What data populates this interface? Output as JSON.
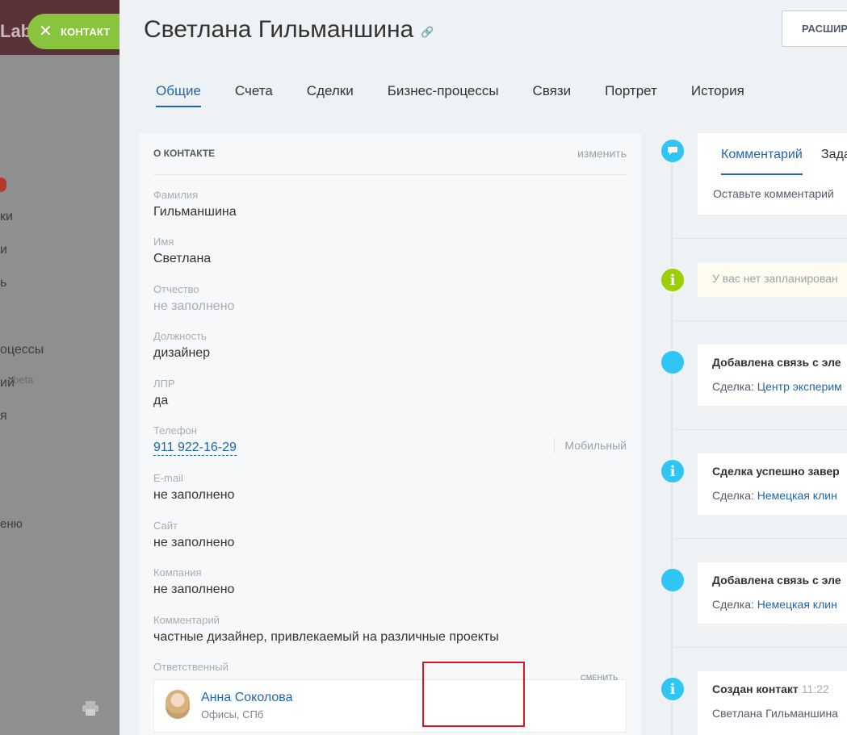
{
  "background": {
    "logo_fragment": "Lab",
    "menu_items": [
      "ки",
      "и",
      "ь",
      "оцессы",
      "ий",
      "я",
      "еню"
    ],
    "beta_label": "beta"
  },
  "close_button": {
    "label": "КОНТАКТ",
    "icon": "close-icon"
  },
  "header": {
    "title": "Светлана  Гильманшина",
    "expand_button": "РАСШИР"
  },
  "tabs": [
    "Общие",
    "Счета",
    "Сделки",
    "Бизнес-процессы",
    "Связи",
    "Портрет",
    "История"
  ],
  "active_tab": "Общие",
  "contact_card": {
    "heading": "О КОНТАКТЕ",
    "edit_label": "изменить",
    "fields": [
      {
        "label": "Фамилия",
        "value": "Гильманшина"
      },
      {
        "label": "Имя",
        "value": "Светлана"
      },
      {
        "label": "Отчество",
        "value": "не заполнено"
      },
      {
        "label": "Должность",
        "value": "дизайнер"
      },
      {
        "label": "ЛПР",
        "value": "да"
      },
      {
        "label": "Телефон",
        "value": "911 922-16-29",
        "type": "Мобильный"
      },
      {
        "label": "E-mail",
        "value": "не заполнено"
      },
      {
        "label": "Сайт",
        "value": "не заполнено"
      },
      {
        "label": "Компания",
        "value": "не заполнено"
      },
      {
        "label": "Комментарий",
        "value": "частные дизайнер, привлекаемый на различные проекты"
      }
    ],
    "responsible": {
      "label": "Ответственный",
      "name": "Анна Соколова",
      "office": "Офисы, СПб",
      "change_label": "СМЕНИТЬ"
    }
  },
  "timeline": {
    "editor_tabs": [
      "Комментарий",
      "Зада"
    ],
    "comment_placeholder": "Оставьте комментарий",
    "planned_note": "У вас нет запланирован",
    "events": [
      {
        "title": "Добавлена связь с эле",
        "prefix": "Сделка:",
        "link": "Центр эксперим"
      },
      {
        "title": "Сделка успешно завер",
        "prefix": "Сделка:",
        "link": "Немецкая клин"
      },
      {
        "title": "Добавлена связь с эле",
        "prefix": "Сделка:",
        "link": "Немецкая клин"
      },
      {
        "title": "Создан контакт",
        "time": "11:22",
        "text": "Светлана Гильманшина"
      }
    ]
  },
  "colors": {
    "accent_blue": "#2066b0",
    "close_green": "#8ac43f",
    "timeline_blue": "#2fc6f6",
    "timeline_green": "#9dcf00",
    "highlight_red": "#e3141f"
  }
}
